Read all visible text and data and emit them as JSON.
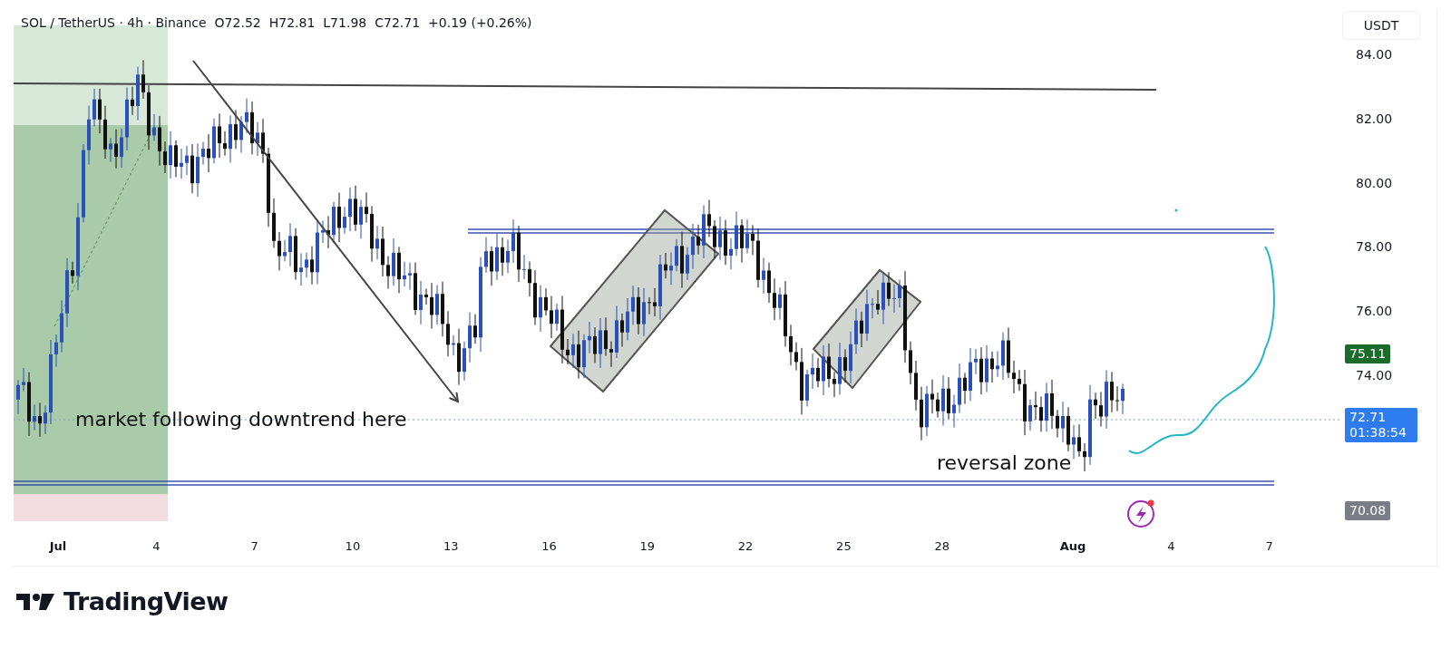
{
  "header": {
    "symbol": "SOL / TetherUS · 4h · Binance",
    "open": "O72.52",
    "high": "H72.81",
    "low": "L71.98",
    "close": "C72.71",
    "change": "+0.19 (+0.26%)"
  },
  "price_axis": {
    "currency": "USDT",
    "ticks": [
      "84.00",
      "82.00",
      "80.00",
      "78.00",
      "76.00",
      "74.00"
    ],
    "tags": [
      {
        "kind": "target",
        "text": "75.11",
        "color": "#1b6b2a"
      },
      {
        "kind": "last",
        "text": "72.71",
        "countdown": "01:38:54",
        "color": "#2f7bf0"
      },
      {
        "kind": "stop",
        "text": "70.08",
        "color": "#7b7d86"
      }
    ]
  },
  "annotations": [
    {
      "text": "market following downtrend here"
    },
    {
      "text": "reversal zone"
    }
  ],
  "time_axis": [
    {
      "label": "Jul",
      "kind": "month"
    },
    {
      "label": "4",
      "kind": "day"
    },
    {
      "label": "7",
      "kind": "day"
    },
    {
      "label": "10",
      "kind": "day"
    },
    {
      "label": "13",
      "kind": "day"
    },
    {
      "label": "16",
      "kind": "day"
    },
    {
      "label": "19",
      "kind": "day"
    },
    {
      "label": "22",
      "kind": "day"
    },
    {
      "label": "25",
      "kind": "day"
    },
    {
      "label": "28",
      "kind": "day"
    },
    {
      "label": "Aug",
      "kind": "month"
    },
    {
      "label": "4",
      "kind": "day"
    },
    {
      "label": "7",
      "kind": "day"
    }
  ],
  "brand": "TradingView"
}
